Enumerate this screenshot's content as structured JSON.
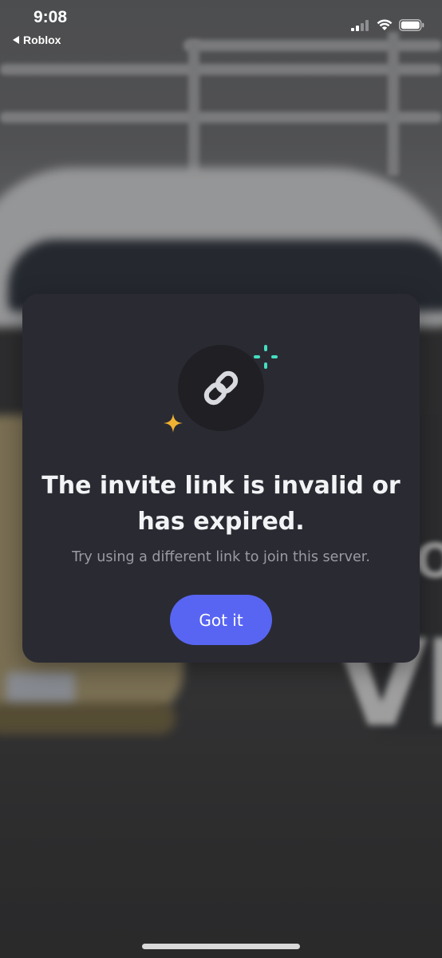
{
  "status_bar": {
    "time": "9:08",
    "back_app": "Roblox",
    "icons": [
      "cellular-signal-icon",
      "wifi-icon",
      "battery-icon"
    ]
  },
  "modal": {
    "icon": "link-icon",
    "decorations": [
      "sparkle-yellow-icon",
      "sparkle-teal-icon"
    ],
    "title": "The invite link is invalid or has expired.",
    "subtitle": "Try using a different link to join this server.",
    "button_label": "Got it"
  },
  "colors": {
    "modal_background": "#2a2a33",
    "button_accent": "#5865f2",
    "sparkle_yellow": "#f0b232",
    "sparkle_teal": "#45ddc0"
  }
}
